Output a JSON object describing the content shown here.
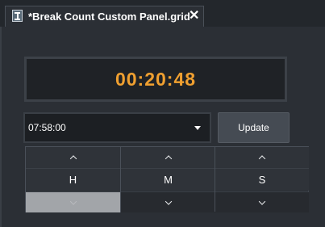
{
  "tab": {
    "title": "*Break Count Custom Panel.grid",
    "close_glyph": "✕",
    "icon": "grid-file-icon"
  },
  "timer": {
    "value": "00:20:48",
    "color": "#f0a030"
  },
  "time_select": {
    "value": "07:58:00"
  },
  "update_button": {
    "label": "Update"
  },
  "spinners": [
    {
      "label": "H",
      "up_icon": "chevron-up-icon",
      "down_icon": "chevron-down-icon",
      "down_disabled": true
    },
    {
      "label": "M",
      "up_icon": "chevron-up-icon",
      "down_icon": "chevron-down-icon",
      "down_disabled": false
    },
    {
      "label": "S",
      "up_icon": "chevron-up-icon",
      "down_icon": "chevron-down-icon",
      "down_disabled": false
    }
  ]
}
